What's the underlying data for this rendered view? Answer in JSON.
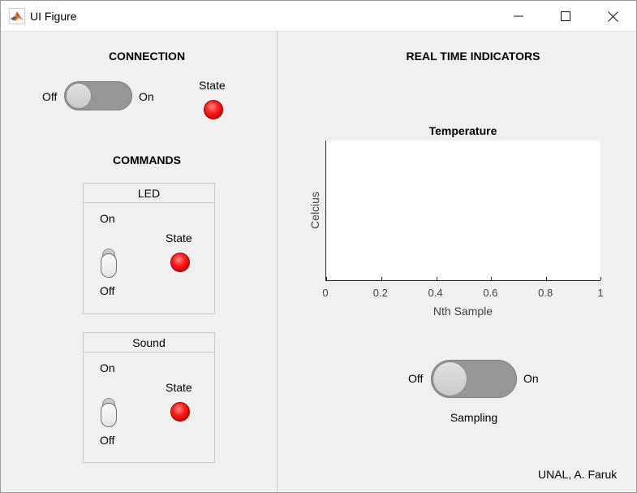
{
  "window": {
    "title": "UI Figure"
  },
  "connection": {
    "heading": "CONNECTION",
    "switch_off": "Off",
    "switch_on": "On",
    "switch_value": "Off",
    "state_label": "State",
    "lamp_color": "#ff0000"
  },
  "commands": {
    "heading": "COMMANDS",
    "panels": [
      {
        "title": "LED",
        "toggle_on": "On",
        "toggle_off": "Off",
        "toggle_value": "Off",
        "state_label": "State",
        "lamp_color": "#ff0000"
      },
      {
        "title": "Sound",
        "toggle_on": "On",
        "toggle_off": "Off",
        "toggle_value": "Off",
        "state_label": "State",
        "lamp_color": "#ff0000"
      }
    ]
  },
  "indicators": {
    "heading": "REAL TIME INDICATORS",
    "sampling": {
      "switch_off": "Off",
      "switch_on": "On",
      "switch_value": "Off",
      "label": "Sampling"
    }
  },
  "chart_data": {
    "type": "line",
    "title": "Temperature",
    "xlabel": "Nth Sample",
    "ylabel": "Celcius",
    "xlim": [
      0,
      1
    ],
    "x_ticks": [
      "0",
      "0.2",
      "0.4",
      "0.6",
      "0.8",
      "1"
    ],
    "series": []
  },
  "footer": {
    "credit": "UNAL, A. Faruk"
  }
}
